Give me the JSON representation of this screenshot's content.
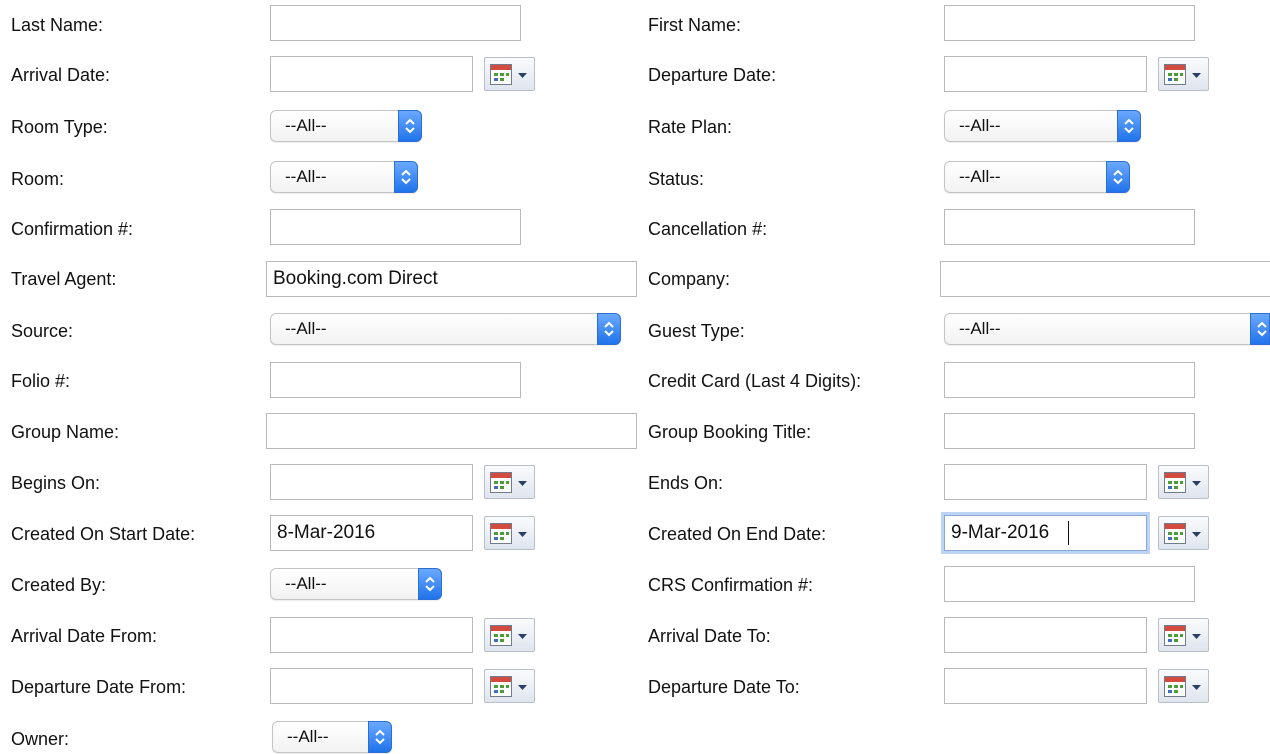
{
  "left_fields": {
    "last_name": {
      "label": "Last Name:",
      "value": ""
    },
    "arrival_date": {
      "label": "Arrival Date:",
      "value": ""
    },
    "room_type": {
      "label": "Room Type:",
      "value": "--All--"
    },
    "room": {
      "label": "Room:",
      "value": "--All--"
    },
    "confirmation": {
      "label": "Confirmation #:",
      "value": ""
    },
    "travel_agent": {
      "label": "Travel Agent:",
      "value": "Booking.com Direct"
    },
    "source": {
      "label": "Source:",
      "value": "--All--"
    },
    "folio": {
      "label": "Folio #:",
      "value": ""
    },
    "group_name": {
      "label": "Group Name:",
      "value": ""
    },
    "begins_on": {
      "label": "Begins On:",
      "value": ""
    },
    "created_start": {
      "label": "Created On Start Date:",
      "value": "8-Mar-2016"
    },
    "created_by": {
      "label": "Created By:",
      "value": "--All--"
    },
    "arrival_from": {
      "label": "Arrival Date From:",
      "value": ""
    },
    "departure_from": {
      "label": "Departure Date From:",
      "value": ""
    },
    "owner": {
      "label": "Owner:",
      "value": "--All--"
    }
  },
  "right_fields": {
    "first_name": {
      "label": "First Name:",
      "value": ""
    },
    "departure_date": {
      "label": "Departure Date:",
      "value": ""
    },
    "rate_plan": {
      "label": "Rate Plan:",
      "value": "--All--"
    },
    "status": {
      "label": "Status:",
      "value": "--All--"
    },
    "cancellation": {
      "label": "Cancellation #:",
      "value": ""
    },
    "company": {
      "label": "Company:",
      "value": ""
    },
    "guest_type": {
      "label": "Guest Type:",
      "value": "--All--"
    },
    "credit_card": {
      "label": "Credit Card (Last 4 Digits):",
      "value": ""
    },
    "group_booking_title": {
      "label": "Group Booking Title:",
      "value": ""
    },
    "ends_on": {
      "label": "Ends On:",
      "value": ""
    },
    "created_end": {
      "label": "Created On End Date:",
      "value": "9-Mar-2016"
    },
    "crs_confirmation": {
      "label": "CRS Confirmation #:",
      "value": ""
    },
    "arrival_to": {
      "label": "Arrival Date To:",
      "value": ""
    },
    "departure_to": {
      "label": "Departure Date To:",
      "value": ""
    }
  },
  "icons": {
    "calendar": "calendar-picker-icon",
    "select_arrows": "updown-chevron-icon"
  },
  "colors": {
    "select_accent": "#1f73ea",
    "focus_ring": "#bcd3f3"
  }
}
